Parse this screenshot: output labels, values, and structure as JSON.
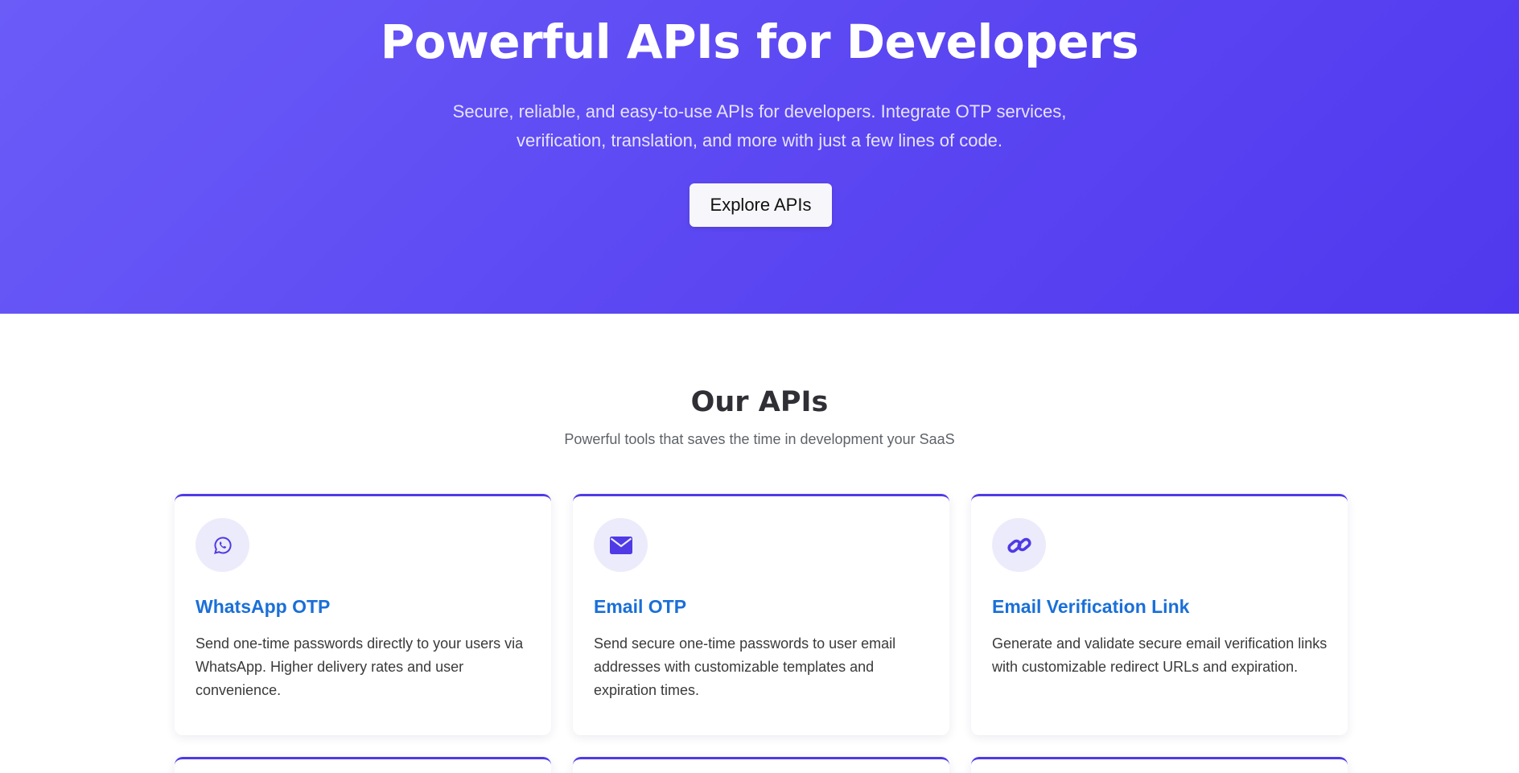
{
  "hero": {
    "title": "Powerful APIs for Developers",
    "subtitle": "Secure, reliable, and easy-to-use APIs for developers. Integrate OTP services, verification, translation, and more with just a few lines of code.",
    "cta_label": "Explore APIs"
  },
  "apis_section": {
    "title": "Our APIs",
    "subtitle": "Powerful tools that saves the time in development your SaaS",
    "cards": [
      {
        "icon": "whatsapp-icon",
        "title": "WhatsApp OTP",
        "description": "Send one-time passwords directly to your users via WhatsApp. Higher delivery rates and user convenience."
      },
      {
        "icon": "envelope-icon",
        "title": "Email OTP",
        "description": "Send secure one-time passwords to user email addresses with customizable templates and expiration times."
      },
      {
        "icon": "link-icon",
        "title": "Email Verification Link",
        "description": "Generate and validate secure email verification links with customizable redirect URLs and expiration."
      }
    ]
  },
  "colors": {
    "hero_gradient_start": "#6b5cf8",
    "hero_gradient_end": "#5038ee",
    "accent": "#4f3ae6",
    "card_title": "#1a6fd8",
    "icon_bg": "#ecebfb"
  }
}
